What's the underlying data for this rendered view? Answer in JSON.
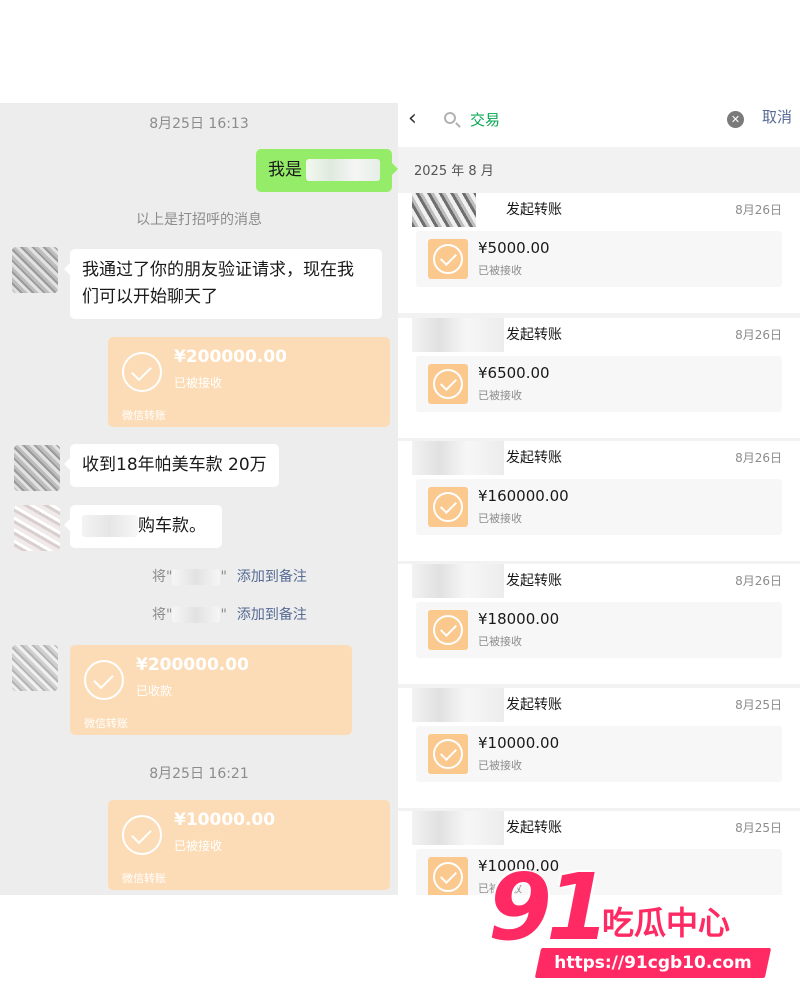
{
  "chat": {
    "timestamp_1": "8月25日 16:13",
    "timestamp_2": "8月25日 16:21",
    "greeting_prefix": "我是",
    "system_note": "以上是打招呼的消息",
    "friend_msg_line1": "我通过了你的朋友验证请求，现在我",
    "friend_msg_line2": "们可以开始聊天了",
    "msg_car_payment": "收到18年帕美车款 20万",
    "msg_car_purchase": "购车款。",
    "remark_prefix": "将\"",
    "remark_suffix": "\"",
    "remark_link": "添加到备注",
    "transfers": [
      {
        "amount": "¥200000.00",
        "status": "已被接收",
        "footer": "微信转账"
      },
      {
        "amount": "¥200000.00",
        "status": "已收款",
        "footer": "微信转账"
      },
      {
        "amount": "¥10000.00",
        "status": "已被接收",
        "footer": "微信转账"
      }
    ]
  },
  "search": {
    "back_icon": "chevron-left-icon",
    "query": "交易",
    "cancel_label": "取消",
    "month_header": "2025 年 8 月",
    "items": [
      {
        "title": "发起转账",
        "date": "8月26日",
        "amount": "¥5000.00",
        "status": "已被接收"
      },
      {
        "title": "发起转账",
        "date": "8月26日",
        "amount": "¥6500.00",
        "status": "已被接收"
      },
      {
        "title": "发起转账",
        "date": "8月26日",
        "amount": "¥160000.00",
        "status": "已被接收"
      },
      {
        "title": "发起转账",
        "date": "8月26日",
        "amount": "¥18000.00",
        "status": "已被接收"
      },
      {
        "title": "发起转账",
        "date": "8月25日",
        "amount": "¥10000.00",
        "status": "已被接收"
      },
      {
        "title": "发起转账",
        "date": "8月25日",
        "amount": "¥10000.00",
        "status": "已被接收"
      }
    ]
  },
  "watermark": {
    "logo_number": "91",
    "logo_text": "吃瓜中心",
    "url": "https://91cgb10.com"
  },
  "colors": {
    "chat_bg": "#ededed",
    "self_bubble": "#95ec69",
    "transfer_card": "#fcdcb6",
    "link": "#576b95",
    "search_text": "#07a852",
    "watermark": "#ff2a63"
  }
}
